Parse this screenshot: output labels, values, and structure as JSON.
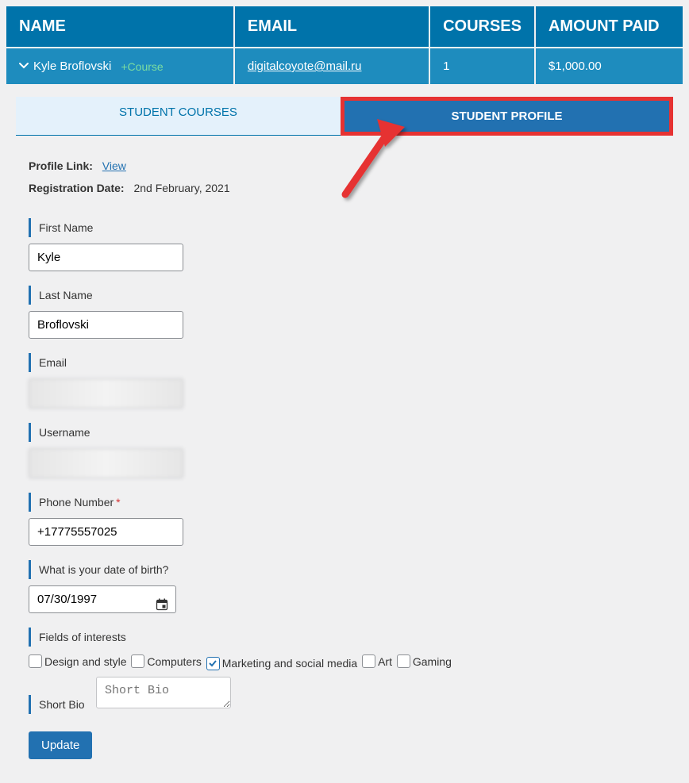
{
  "table": {
    "headers": {
      "name": "NAME",
      "email": "EMAIL",
      "courses": "COURSES",
      "amount": "AMOUNT PAID"
    },
    "row": {
      "name": "Kyle Broflovski",
      "add_course": "+Course",
      "email": "digitalcoyote@mail.ru",
      "courses": "1",
      "amount": "$1,000.00"
    }
  },
  "tabs": {
    "courses": "STUDENT COURSES",
    "profile": "STUDENT PROFILE"
  },
  "profile": {
    "profile_link_label": "Profile Link:",
    "profile_link_text": "View",
    "reg_label": "Registration Date:",
    "reg_value": "2nd February, 2021",
    "first_name_label": "First Name",
    "first_name_value": "Kyle",
    "last_name_label": "Last Name",
    "last_name_value": "Broflovski",
    "email_label": "Email",
    "username_label": "Username",
    "phone_label": "Phone Number",
    "phone_value": "+17775557025",
    "dob_label": "What is your date of birth?",
    "dob_value": "07/30/1997",
    "interests_label": "Fields of interests",
    "interests": {
      "design": "Design and style",
      "computers": "Computers",
      "marketing": "Marketing and social media",
      "art": "Art",
      "gaming": "Gaming",
      "checked": "marketing"
    },
    "bio_label": "Short Bio",
    "bio_placeholder": "Short Bio",
    "update_btn": "Update"
  }
}
